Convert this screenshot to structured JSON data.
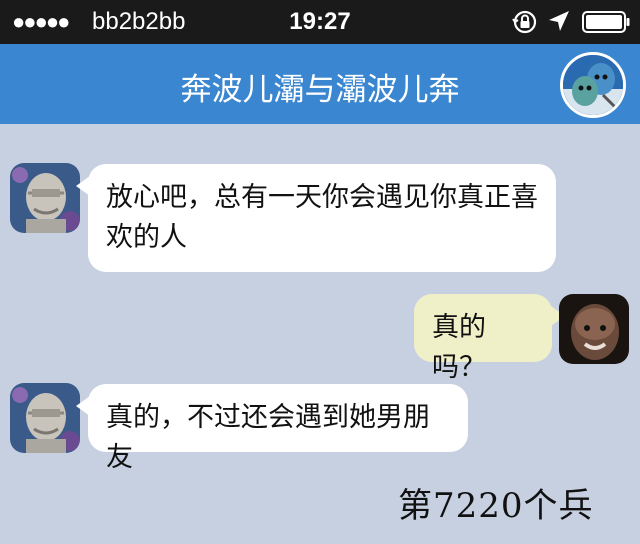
{
  "status_bar": {
    "signal": "●●●●●",
    "carrier": "bb2b2bb",
    "time": "19:27"
  },
  "nav": {
    "title": "奔波儿灞与灞波儿奔"
  },
  "messages": [
    {
      "sender": "left",
      "text_line1": "放心吧，总有一天你会遇见你真正喜",
      "text_line2": "欢的人"
    },
    {
      "sender": "right",
      "text": "真的吗？"
    },
    {
      "sender": "left",
      "text": "真的，不过还会遇到她男朋友"
    }
  ],
  "watermark": "第7220个兵",
  "colors": {
    "nav_bg": "#3a86d0",
    "chat_bg": "#c6d0e0",
    "bubble_left": "#ffffff",
    "bubble_right": "#f0f0c8"
  }
}
